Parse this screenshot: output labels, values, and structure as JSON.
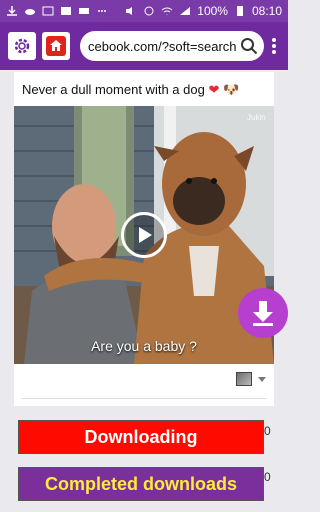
{
  "status_bar": {
    "battery": "100%",
    "time": "08:10",
    "bg_color": "#7a3aa8"
  },
  "toolbar": {
    "url": "cebook.com/?soft=search",
    "settings_icon": "gear-icon",
    "home_icon": "home-icon",
    "search_icon": "search-icon",
    "menu_icon": "more-vertical-icon",
    "bg_color": "#6e2a9e"
  },
  "post": {
    "title": "Never a dull moment with a dog",
    "title_emoji_heart": "❤",
    "title_emoji_dog": "🐶",
    "video_caption": "Are you a baby ?",
    "video_watermark": "Jukin",
    "play_icon": "play-icon",
    "download_icon": "download-icon",
    "fab_color": "#b63fd0"
  },
  "buttons": {
    "downloading": "Downloading",
    "downloading_count": "0",
    "completed": "Completed downloads",
    "completed_count": "0",
    "downloading_color": "#ff0a00",
    "completed_color": "#7b2f9b",
    "completed_text_color": "#ffec3a"
  }
}
